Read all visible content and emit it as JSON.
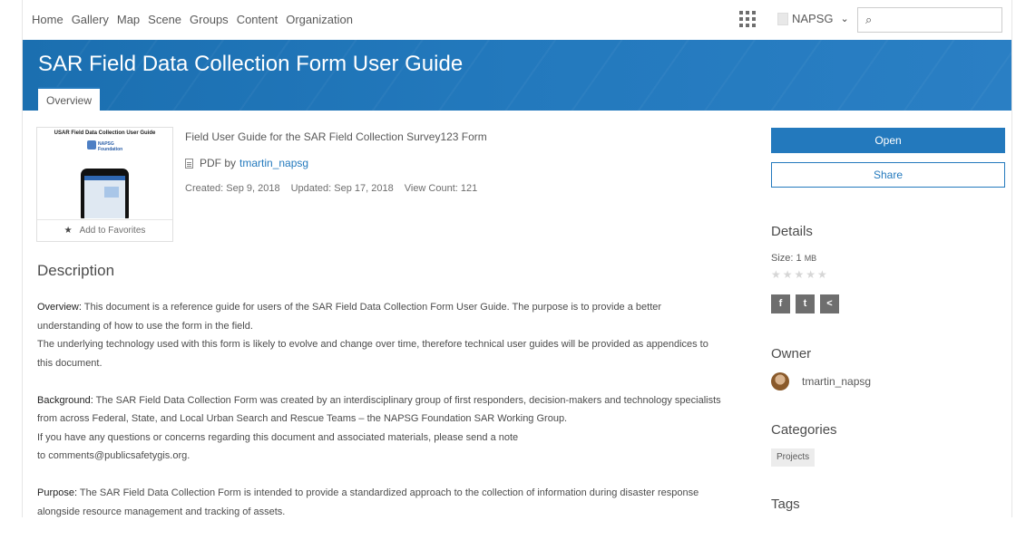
{
  "nav": {
    "links": [
      "Home",
      "Gallery",
      "Map",
      "Scene",
      "Groups",
      "Content",
      "Organization"
    ],
    "user": "NAPSG",
    "search_placeholder": ""
  },
  "banner": {
    "title": "SAR Field Data Collection Form User Guide",
    "tab": "Overview"
  },
  "thumbnail": {
    "title": "USAR Field Data Collection User Guide",
    "logo_text": "NAPSG Foundation",
    "favorites": "Add to Favorites"
  },
  "item": {
    "summary": "Field User Guide for the SAR Field Collection Survey123 Form",
    "type": "PDF by",
    "owner": "tmartin_napsg",
    "created": "Created: Sep 9, 2018",
    "updated": "Updated: Sep 17, 2018",
    "views": "View Count: 121"
  },
  "description": {
    "heading": "Description",
    "p1_label": "Overview:",
    "p1_text": " This document is a reference guide for users of the SAR Field Data Collection Form User Guide. The purpose is to provide a better understanding of how to use the form in the field.",
    "p1b_text": "The underlying technology used with this form is likely to evolve and change over time, therefore technical user guides will be provided as appendices to this document.",
    "p2_label": "Background:",
    "p2_text": " The SAR Field Data Collection Form was created by an interdisciplinary group of first responders, decision-makers and technology specialists from across Federal, State, and Local Urban Search and Rescue Teams – the NAPSG Foundation SAR Working Group.",
    "p2b_text": "If you have any questions or concerns regarding this document and associated materials, please send a note",
    "p2c_prefix": "to ",
    "email": "comments@publicsafetygis.org",
    "p2c_suffix": ".",
    "p3_label": "Purpose:",
    "p3_text": "  The SAR Field Data Collection Form is intended to provide a standardized approach to the collection of information during disaster response alongside resource management and tracking of assets."
  },
  "sidebar": {
    "open": "Open",
    "share": "Share",
    "details": "Details",
    "size_label": "Size: 1 ",
    "size_unit": "MB",
    "stars": "★★★★★",
    "owner_heading": "Owner",
    "owner": "tmartin_napsg",
    "categories_heading": "Categories",
    "category": "Projects",
    "tags_heading": "Tags",
    "social": [
      "f",
      "t",
      "<"
    ]
  },
  "colors": {
    "accent": "#2379bd"
  }
}
